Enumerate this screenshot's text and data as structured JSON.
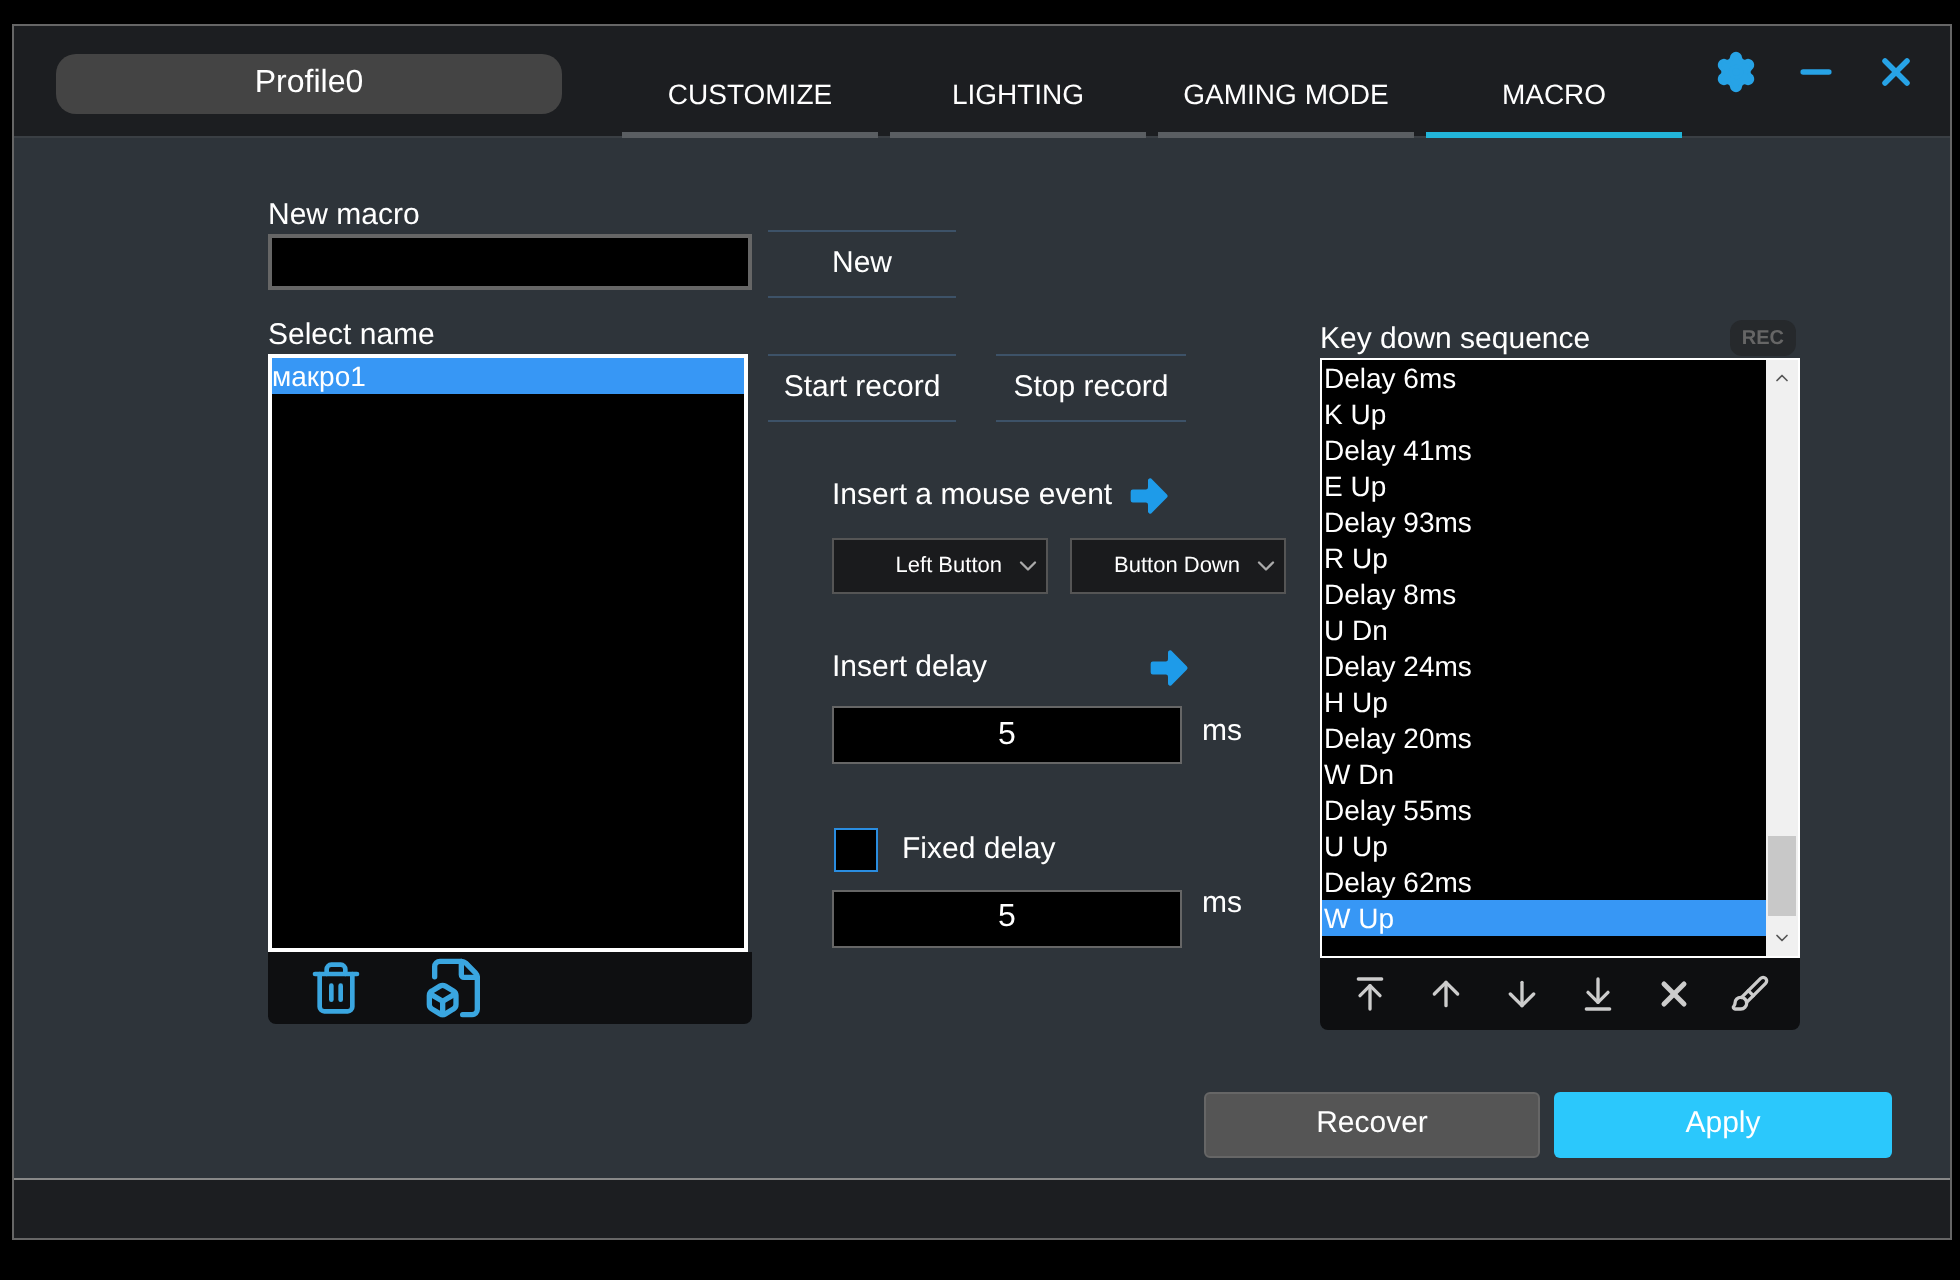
{
  "profile": "Profile0",
  "tabs": [
    {
      "label": "CUSTOMIZE",
      "selected": false
    },
    {
      "label": "LIGHTING",
      "selected": false
    },
    {
      "label": "GAMING MODE",
      "selected": false
    },
    {
      "label": "MACRO",
      "selected": true
    }
  ],
  "new_macro": {
    "label": "New macro",
    "button": "New"
  },
  "select_name": {
    "label": "Select name",
    "items": [
      {
        "label": "макро1",
        "selected": true
      }
    ]
  },
  "record": {
    "start": "Start record",
    "stop": "Stop record"
  },
  "mouse_event": {
    "label": "Insert a mouse event",
    "button_select": "Left Button",
    "action_select": "Button Down"
  },
  "insert_delay": {
    "label": "Insert delay",
    "value": "5",
    "unit": "ms"
  },
  "fixed_delay": {
    "label": "Fixed delay",
    "checked": false,
    "value": "5",
    "unit": "ms"
  },
  "sequence": {
    "label": "Key down sequence",
    "rec": "REC",
    "items": [
      {
        "label": "Delay 6ms",
        "selected": false
      },
      {
        "label": "K Up",
        "selected": false
      },
      {
        "label": "Delay 41ms",
        "selected": false
      },
      {
        "label": "E Up",
        "selected": false
      },
      {
        "label": "Delay 93ms",
        "selected": false
      },
      {
        "label": "R Up",
        "selected": false
      },
      {
        "label": "Delay 8ms",
        "selected": false
      },
      {
        "label": "U Dn",
        "selected": false
      },
      {
        "label": "Delay 24ms",
        "selected": false
      },
      {
        "label": "H Up",
        "selected": false
      },
      {
        "label": "Delay 20ms",
        "selected": false
      },
      {
        "label": "W Dn",
        "selected": false
      },
      {
        "label": "Delay 55ms",
        "selected": false
      },
      {
        "label": "U Up",
        "selected": false
      },
      {
        "label": "Delay 62ms",
        "selected": false
      },
      {
        "label": "W Up",
        "selected": true
      }
    ]
  },
  "buttons": {
    "recover": "Recover",
    "apply": "Apply"
  }
}
